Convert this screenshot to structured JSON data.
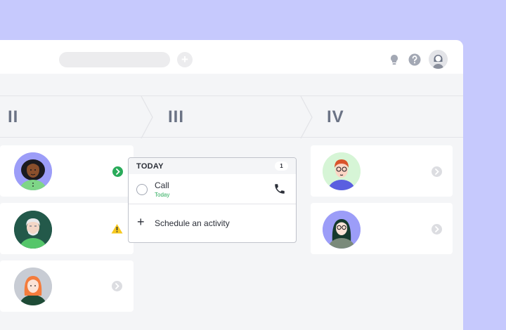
{
  "header": {
    "search_placeholder": "",
    "add_label": "+",
    "icons": [
      "lightbulb-icon",
      "help-icon",
      "user-avatar"
    ]
  },
  "stages": [
    {
      "label": "II"
    },
    {
      "label": "III"
    },
    {
      "label": "IV"
    }
  ],
  "column_ii": {
    "deals": [
      {
        "avatar": "person-dark-curly-hair",
        "status": "next-activity-planned",
        "status_color": "#2aab5a"
      },
      {
        "avatar": "person-white-hair-beard",
        "status": "warning",
        "status_color": "#f6c81e"
      },
      {
        "avatar": "person-orange-hair",
        "status": "no-activity",
        "status_color": "#dcdde1"
      }
    ]
  },
  "column_iv": {
    "deals": [
      {
        "avatar": "person-glasses-red-hair",
        "status": "no-activity",
        "status_color": "#dcdde1"
      },
      {
        "avatar": "person-dark-long-hair-glasses",
        "status": "no-activity",
        "status_color": "#dcdde1"
      }
    ]
  },
  "activity_popup": {
    "title": "TODAY",
    "count": "1",
    "activities": [
      {
        "name": "Call",
        "date": "Today",
        "icon": "phone-icon"
      }
    ],
    "schedule_label": "Schedule an activity"
  },
  "colors": {
    "background": "#c6c9fd",
    "success": "#2aab5a",
    "warning": "#f6c81e",
    "stage_text": "#6b7385"
  }
}
